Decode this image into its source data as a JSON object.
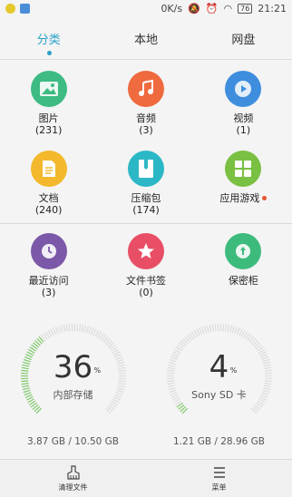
{
  "status_bar": {
    "net_speed": "0K/s",
    "battery": "76",
    "time": "21:21"
  },
  "tabs": [
    {
      "label": "分类",
      "active": true
    },
    {
      "label": "本地",
      "active": false
    },
    {
      "label": "网盘",
      "active": false
    }
  ],
  "categories": [
    {
      "label": "图片",
      "count": "(231)",
      "icon": "picture-icon",
      "color": "#3dbb82"
    },
    {
      "label": "音频",
      "count": "(3)",
      "icon": "music-icon",
      "color": "#ef6a3e"
    },
    {
      "label": "视频",
      "count": "(1)",
      "icon": "video-icon",
      "color": "#3f8ede"
    },
    {
      "label": "文档",
      "count": "(240)",
      "icon": "document-icon",
      "color": "#f3b82c"
    },
    {
      "label": "压缩包",
      "count": "(174)",
      "icon": "archive-icon",
      "color": "#2cb7c6"
    },
    {
      "label": "应用游戏",
      "count": "",
      "icon": "apps-icon",
      "color": "#7ac043",
      "new_badge": true
    },
    {
      "label": "最近访问",
      "count": "(3)",
      "icon": "clock-icon",
      "color": "#7b58a8"
    },
    {
      "label": "文件书签",
      "count": "(0)",
      "icon": "star-icon",
      "color": "#e84e65"
    },
    {
      "label": "保密柜",
      "count": "",
      "icon": "safe-icon",
      "color": "#3dbb7d"
    }
  ],
  "storage": [
    {
      "percent": "36",
      "percent_sign": "%",
      "name": "内部存储",
      "size": "3.87 GB / 10.50 GB",
      "used_fraction": 0.36
    },
    {
      "percent": "4",
      "percent_sign": "%",
      "name": "Sony SD 卡",
      "size": "1.21 GB / 28.96 GB",
      "used_fraction": 0.04
    }
  ],
  "bottom_bar": {
    "clean_label": "清理文件",
    "menu_label": "菜单"
  },
  "colors": {
    "accent": "#2aa0c8",
    "gauge_fill": "#7ec86a",
    "gauge_track": "#dcdcdc"
  }
}
